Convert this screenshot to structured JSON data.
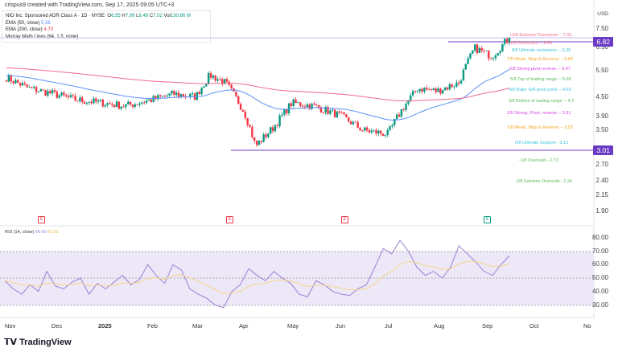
{
  "header": {
    "credit": "crispus9 created with TradingView.com, Sep 17, 2025 09:05 UTC+3"
  },
  "legend": {
    "symbol": "NIO Inc. Sponsored ADR Class A · 1D · NYSE",
    "o_label": "O",
    "o": "6.55",
    "h_label": "H",
    "h": "7.09",
    "l_label": "L",
    "l": "6.48",
    "c_label": "C",
    "c": "7.02",
    "vol_label": "Vol",
    "vol": "130.66 M",
    "ema50": "EMA (50, close)",
    "ema50_val": "5.36",
    "ema200": "EMA (200, close)",
    "ema200_val": "4.70",
    "murray": "Murray Math Lines (64, 1.5, none)"
  },
  "colors": {
    "up": "#089981",
    "down": "#f23645",
    "ema50": "#5b8ff9",
    "ema200": "#f06a8a",
    "badge": "#6a3bc4",
    "rsi": "#9b7fd6",
    "rsi_ma": "#f5d68a"
  },
  "price_axis": {
    "currency": "USD",
    "ticks": [
      "7.50",
      "6.50",
      "5.50",
      "4.50",
      "3.90",
      "3.50",
      "2.70",
      "2.40",
      "2.15",
      "1.90"
    ],
    "last_badge": "6.82",
    "low_badge": "3.01",
    "scale": "log"
  },
  "murray": [
    {
      "label": "+2/8 Extreme Overshoot --  7.03",
      "color": "#f06a8a"
    },
    {
      "label": "+1/8 Overshoot --  6.64",
      "color": "#f06a8a"
    },
    {
      "label": "8/8 Ultimate resistance --  6.25",
      "color": "#3cc3dc"
    },
    {
      "label": "7/8 Weak, Stop & Reverse --  5.86",
      "color": "#f5a623"
    },
    {
      "label": "6/8 Strong pivot reverse --  5.47",
      "color": "#d63fe6"
    },
    {
      "label": "5/8 Top of trading range --  5.08",
      "color": "#5cb85c"
    },
    {
      "label": "4/8 Major S/R pivot point --  4.69",
      "color": "#3cc3dc"
    },
    {
      "label": "3/8 Bottom of trading range --  4.3",
      "color": "#5cb85c"
    },
    {
      "label": "2/8 Strong, Pivot, reverse --  3.91",
      "color": "#d63fe6"
    },
    {
      "label": "1/8 Weak, Stop & Reverse --  3.52",
      "color": "#f5a623"
    },
    {
      "label": "0/8 Ultimate Support--  3.13",
      "color": "#3cc3dc"
    },
    {
      "label": "-1/8 Oversold--  2.73",
      "color": "#5cb85c"
    },
    {
      "label": "-2/8 Extreme Oversold--  2.34",
      "color": "#5cb85c"
    }
  ],
  "rsi": {
    "label": "RSI (14, close)",
    "value": "66.60",
    "ma_value": "62.01",
    "ticks": [
      "80.00",
      "70.00",
      "60.00",
      "50.00",
      "40.00",
      "30.00"
    ]
  },
  "time_axis": [
    "Nov",
    "Dec",
    "2025",
    "Feb",
    "Mar",
    "Apr",
    "May",
    "Jun",
    "Jul",
    "Aug",
    "Sep",
    "Oct",
    "No"
  ],
  "earnings_marker": "E",
  "chart_data": {
    "type": "candlestick",
    "price_path": [
      [
        "2024-11-01",
        5.2
      ],
      [
        "2024-11-15",
        4.8
      ],
      [
        "2024-12-01",
        4.6
      ],
      [
        "2024-12-15",
        4.4
      ],
      [
        "2025-01-01",
        4.3
      ],
      [
        "2025-01-15",
        4.2
      ],
      [
        "2025-02-01",
        4.4
      ],
      [
        "2025-02-15",
        4.6
      ],
      [
        "2025-03-01",
        4.5
      ],
      [
        "2025-03-10",
        5.3
      ],
      [
        "2025-03-20",
        5.0
      ],
      [
        "2025-04-01",
        4.0
      ],
      [
        "2025-04-08",
        3.1
      ],
      [
        "2025-04-20",
        3.6
      ],
      [
        "2025-05-01",
        4.3
      ],
      [
        "2025-05-15",
        4.2
      ],
      [
        "2025-06-01",
        3.9
      ],
      [
        "2025-06-15",
        3.5
      ],
      [
        "2025-07-01",
        3.4
      ],
      [
        "2025-07-10",
        4.1
      ],
      [
        "2025-07-20",
        4.8
      ],
      [
        "2025-08-01",
        4.7
      ],
      [
        "2025-08-15",
        5.0
      ],
      [
        "2025-08-25",
        6.5
      ],
      [
        "2025-09-05",
        6.1
      ],
      [
        "2025-09-16",
        7.02
      ]
    ],
    "rsi_path": [
      48,
      42,
      38,
      45,
      40,
      55,
      44,
      42,
      47,
      50,
      38,
      46,
      42,
      47,
      52,
      45,
      49,
      60,
      52,
      46,
      60,
      56,
      42,
      38,
      35,
      30,
      28,
      40,
      45,
      57,
      52,
      48,
      55,
      50,
      46,
      38,
      36,
      48,
      45,
      40,
      38,
      37,
      42,
      45,
      58,
      72,
      68,
      78,
      70,
      58,
      52,
      55,
      50,
      58,
      74,
      68,
      62,
      55,
      52,
      60,
      66.6
    ]
  }
}
